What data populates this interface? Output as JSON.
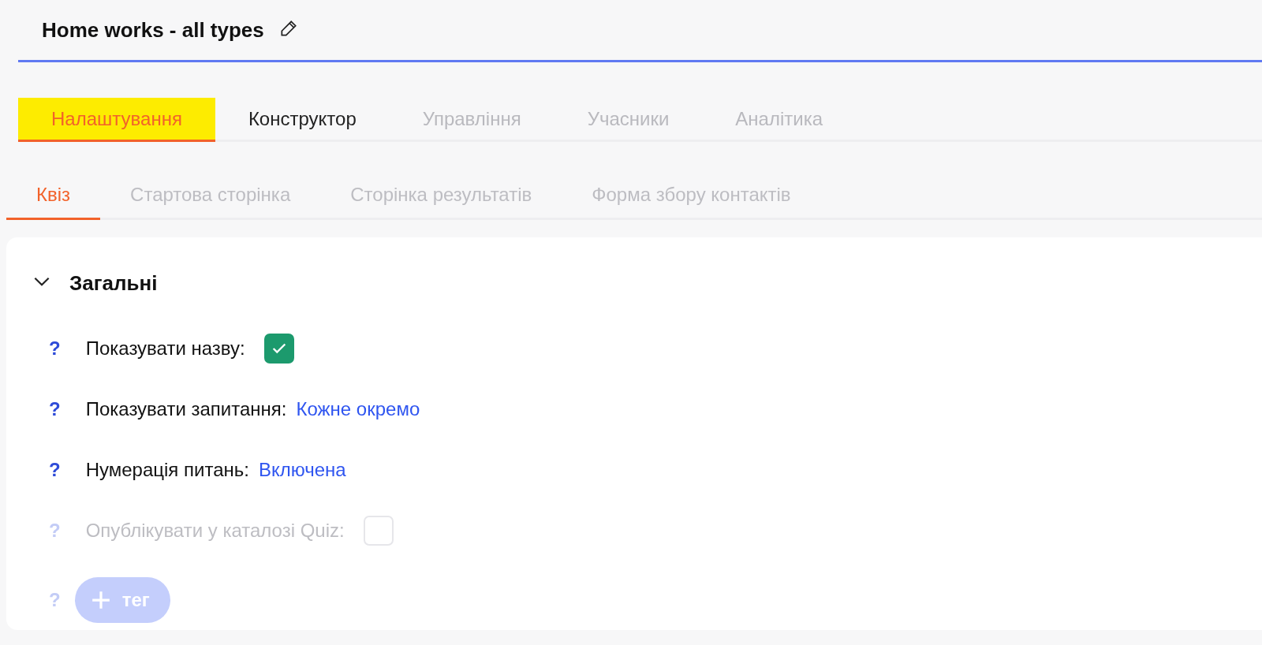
{
  "title": "Home works - all types",
  "tabs": [
    {
      "label": "Налаштування",
      "selected": true,
      "highlighted": true,
      "disabled": false
    },
    {
      "label": "Конструктор",
      "selected": false,
      "highlighted": false,
      "disabled": false
    },
    {
      "label": "Управління",
      "selected": false,
      "highlighted": false,
      "disabled": true
    },
    {
      "label": "Учасники",
      "selected": false,
      "highlighted": false,
      "disabled": true
    },
    {
      "label": "Аналітика",
      "selected": false,
      "highlighted": false,
      "disabled": true
    }
  ],
  "subtabs": [
    {
      "label": "Квіз",
      "selected": true
    },
    {
      "label": "Стартова сторінка",
      "selected": false
    },
    {
      "label": "Сторінка результатів",
      "selected": false
    },
    {
      "label": "Форма збору контактів",
      "selected": false
    }
  ],
  "section": {
    "title": "Загальні",
    "expanded": true,
    "settings": [
      {
        "kind": "checkbox",
        "help": "?",
        "label": "Показувати назву:",
        "checked": true,
        "disabled": false
      },
      {
        "kind": "link",
        "help": "?",
        "label": "Показувати запитання:",
        "value": "Кожне окремо",
        "disabled": false
      },
      {
        "kind": "link",
        "help": "?",
        "label": "Нумерація питань:",
        "value": "Включена",
        "disabled": false
      },
      {
        "kind": "checkbox",
        "help": "?",
        "label": "Опублікувати у каталозі Quiz:",
        "checked": false,
        "disabled": true
      },
      {
        "kind": "button",
        "help": "?",
        "label": "тег",
        "disabled": true
      }
    ]
  }
}
